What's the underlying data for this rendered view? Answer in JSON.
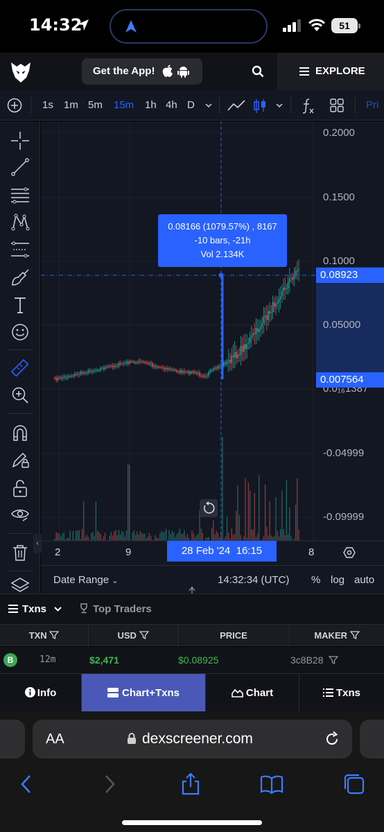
{
  "status": {
    "time": "14:32",
    "battery": "51",
    "icons": [
      "location-arrow-icon",
      "navigation-icon",
      "cellular-signal-icon",
      "wifi-icon",
      "battery-icon"
    ]
  },
  "header": {
    "get_app_label": "Get the App!",
    "explore_label": "EXPLORE",
    "icons": [
      "dexscreener-logo",
      "apple-icon",
      "android-icon",
      "search-icon",
      "menu-icon"
    ]
  },
  "chart_toolbar": {
    "timeframes": [
      "1s",
      "1m",
      "5m",
      "15m",
      "1h",
      "4h",
      "D"
    ],
    "active_timeframe": "15m",
    "price_tab": "Pri"
  },
  "chart": {
    "price_labels": [
      "0.2000",
      "0.1500",
      "0.1000",
      "0.05000",
      "0.0₁₆1387",
      "-0.04999",
      "-0.09999"
    ],
    "current_price": "0.08923",
    "low_price": "0.007564",
    "date_labels": [
      "2",
      "9",
      "8"
    ],
    "crosshair_date": "28 Feb '24",
    "crosshair_time": "16:15",
    "tooltip": {
      "line1": "0.08166 (1079.57%) , 8167",
      "line2": "-10 bars, -21h",
      "line3": "Vol 2.134K"
    },
    "colors": {
      "up": "#26a69a",
      "down": "#ef5350",
      "accent": "#2962ff"
    }
  },
  "range_bar": {
    "date_range_label": "Date Range",
    "clock": "14:32:34 (UTC)",
    "percent_label": "%",
    "log_label": "log",
    "auto_label": "auto"
  },
  "txns": {
    "tab_txns": "Txns",
    "tab_top_traders": "Top Traders",
    "columns": [
      "TXN",
      "USD",
      "PRICE",
      "MAKER"
    ],
    "rows": [
      {
        "type": "B",
        "age": "12m",
        "usd": "$2,471",
        "price": "$0.08925",
        "maker": "3c8B28"
      }
    ]
  },
  "bottom_nav": {
    "info": "Info",
    "chart_txns": "Chart+Txns",
    "chart": "Chart",
    "txns": "Txns"
  },
  "browser": {
    "aa_label": "AA",
    "domain": "dexscreener.com"
  }
}
